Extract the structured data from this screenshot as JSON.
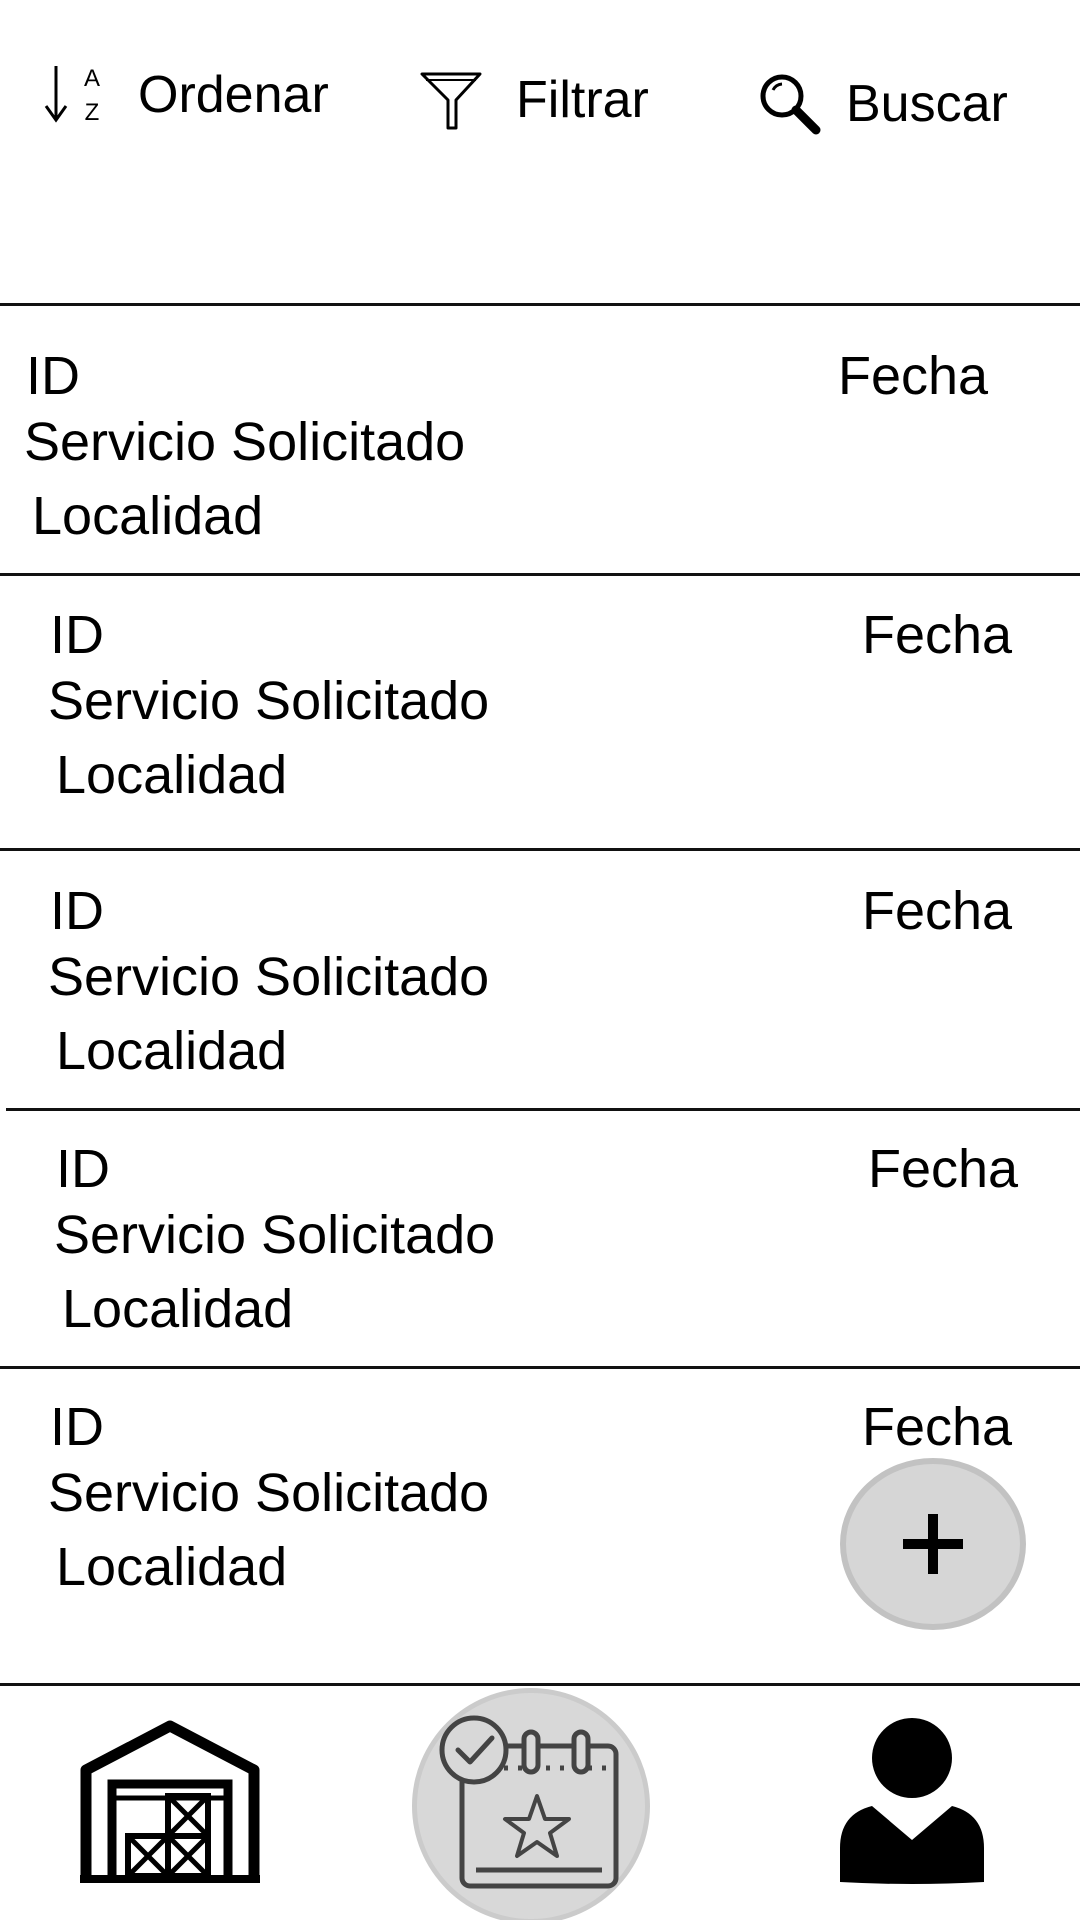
{
  "toolbar": {
    "sort_label": "Ordenar",
    "sort_icon_letters": [
      "A",
      "Z"
    ],
    "filter_label": "Filtrar",
    "search_label": "Buscar"
  },
  "list": {
    "items": [
      {
        "id": "ID",
        "service": "Servicio Solicitado",
        "locality": "Localidad",
        "date": "Fecha"
      },
      {
        "id": "ID",
        "service": "Servicio Solicitado",
        "locality": "Localidad",
        "date": "Fecha"
      },
      {
        "id": "ID",
        "service": "Servicio Solicitado",
        "locality": "Localidad",
        "date": "Fecha"
      },
      {
        "id": "ID",
        "service": "Servicio Solicitado",
        "locality": "Localidad",
        "date": "Fecha"
      },
      {
        "id": "ID",
        "service": "Servicio Solicitado",
        "locality": "Localidad",
        "date": "Fecha"
      }
    ]
  },
  "fab": {
    "icon": "plus-icon"
  },
  "bottom_nav": {
    "items": [
      {
        "icon": "warehouse-icon",
        "active": false
      },
      {
        "icon": "calendar-icon",
        "active": true
      },
      {
        "icon": "user-icon",
        "active": false
      }
    ]
  },
  "colors": {
    "background": "#ffffff",
    "text": "#000000",
    "active_nav_bg": "#d8d8d8",
    "fab_bg": "#d6d6d6"
  }
}
